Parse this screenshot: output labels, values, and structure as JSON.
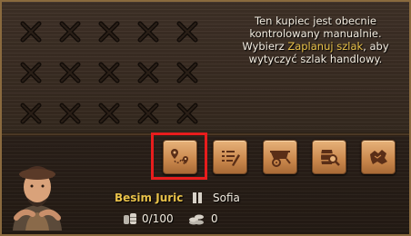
{
  "info": {
    "line1": "Ten kupiec jest obecnie",
    "line2": "kontrolowany manualnie.",
    "line3_prefix": "Wybierz ",
    "line3_link": "Zaplanuj szlak",
    "line3_suffix": ", aby",
    "line4": "wytyczyć szlak handlowy."
  },
  "cargo_slots": {
    "rows": 3,
    "columns": 5,
    "state": "empty"
  },
  "actions": [
    {
      "name": "plan-route",
      "icon": "route-map-icon",
      "highlighted": true
    },
    {
      "name": "trade-list",
      "icon": "list-pen-icon",
      "highlighted": false
    },
    {
      "name": "cart",
      "icon": "cart-icon",
      "highlighted": false
    },
    {
      "name": "barrel-inspect",
      "icon": "barrel-magnifier-icon",
      "highlighted": false
    },
    {
      "name": "region-map",
      "icon": "region-map-icon",
      "highlighted": false
    }
  ],
  "merchant": {
    "name": "Besim Juric",
    "city": "Sofia",
    "status_icon": "pause-icon",
    "capacity": "0/100",
    "coins": "0"
  },
  "colors": {
    "highlight": "#e81d1d",
    "name_text": "#e9c24a",
    "button": "#c9874c"
  }
}
